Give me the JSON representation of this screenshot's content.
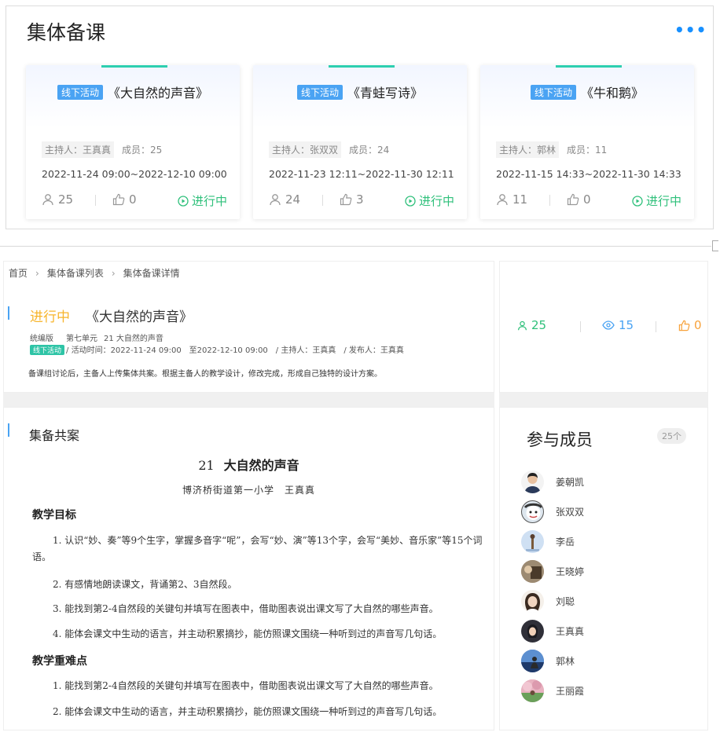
{
  "top": {
    "title": "集体备课",
    "more": "•••",
    "cards": [
      {
        "tag": "线下活动",
        "title": "《大自然的声音》",
        "host": "主持人：王真真",
        "members": "成员：25",
        "time": "2022-11-24 09:00~2022-12-10 09:00",
        "participants": "25",
        "likes": "0",
        "status": "进行中"
      },
      {
        "tag": "线下活动",
        "title": "《青蛙写诗》",
        "host": "主持人：张双双",
        "members": "成员：24",
        "time": "2022-11-23 12:11~2022-11-30 12:11",
        "participants": "24",
        "likes": "3",
        "status": "进行中"
      },
      {
        "tag": "线下活动",
        "title": "《牛和鹅》",
        "host": "主持人：郭林",
        "members": "成员：11",
        "time": "2022-11-15 14:33~2022-11-30 14:33",
        "participants": "11",
        "likes": "0",
        "status": "进行中"
      }
    ]
  },
  "breadcrumb": [
    "首页",
    "集体备课列表",
    "集体备课详情"
  ],
  "detail": {
    "status": "进行中",
    "title": "《大自然的声音》",
    "edition": "统编版",
    "unit": "第七单元",
    "lesson": "21 大自然的声音",
    "tag": "线下活动",
    "info": "/ 活动时间：2022-11-24 09:00　至2022-12-10 09:00　/ 主持人：王真真　/ 发布人：王真真",
    "description": "备课组讨论后，主备人上传集体共案。根据主备人的教学设计，修改完成，形成自己独特的设计方案。"
  },
  "stats": {
    "participants": "25",
    "views": "15",
    "likes": "0"
  },
  "plan": {
    "heading": "集备共案",
    "doc_num": "21",
    "doc_title": "大自然的声音",
    "author": "博济桥街道第一小学　王真真",
    "goals_heading": "教学目标",
    "goals": [
      "1. 认识“妙、奏”等9个生字，掌握多音字“呢”，会写“妙、演”等13个字，会写“美妙、音乐家”等15个词语。",
      "2. 有感情地朗读课文，背诵第2、3自然段。",
      "3. 能找到第2-4自然段的关键句并填写在图表中，借助图表说出课文写了大自然的哪些声音。",
      "4. 能体会课文中生动的语言，并主动积累摘抄，能仿照课文围绕一种听到过的声音写几句话。"
    ],
    "key_heading": "教学重难点",
    "key_points": [
      "1. 能找到第2-4自然段的关键句并填写在图表中，借助图表说出课文写了大自然的哪些声音。",
      "2. 能体会课文中生动的语言，并主动积累摘抄，能仿照课文围绕一种听到过的声音写几句话。"
    ]
  },
  "members": {
    "title": "参与成员",
    "count": "25个",
    "list": [
      "姜朝凯",
      "张双双",
      "李岳",
      "王晓婷",
      "刘聪",
      "王真真",
      "郭林",
      "王丽霞"
    ]
  },
  "colors": {
    "accent": "#4aa3f3",
    "green": "#2fc07b",
    "teal": "#2ecfb0",
    "orange": "#f7a23b",
    "yellow": "#f7b52c"
  }
}
